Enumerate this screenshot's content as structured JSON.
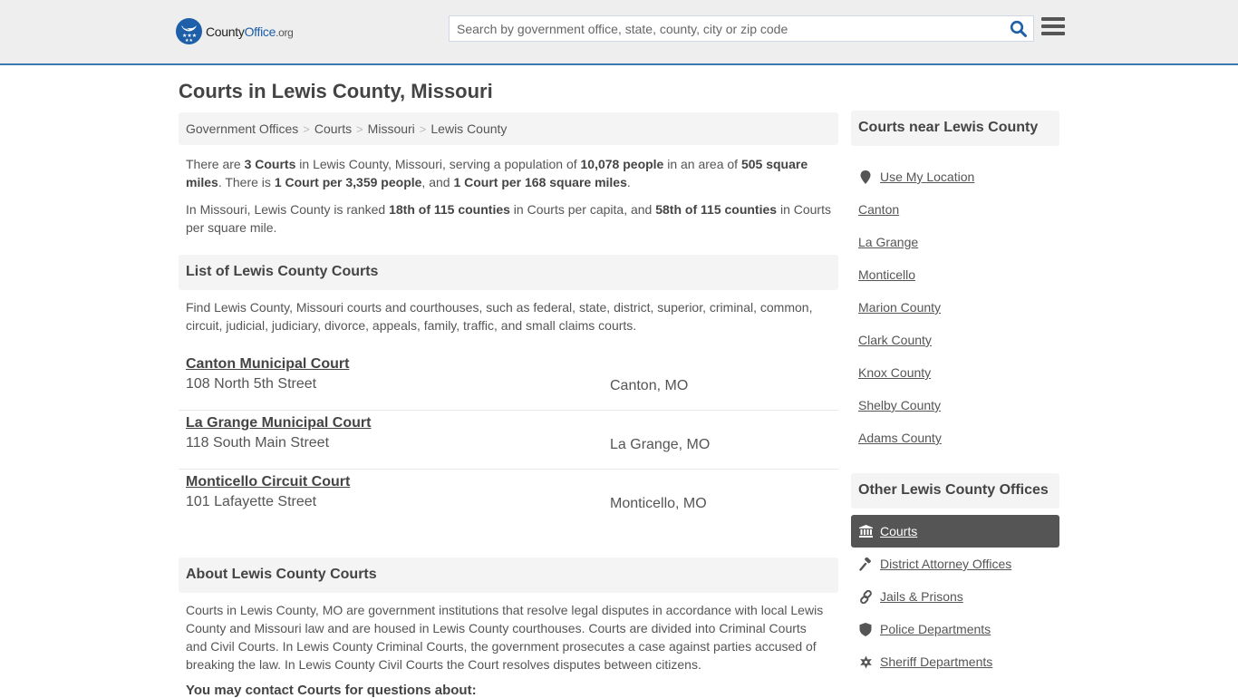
{
  "header": {
    "logo": {
      "county": "County",
      "office": "Office",
      "org": ".org",
      "icon": "eagle-badge-icon"
    },
    "search": {
      "placeholder": "Search by government office, state, county, city or zip code",
      "value": "",
      "icon": "search-icon"
    },
    "menu_icon": "hamburger-menu-icon",
    "colors": {
      "brand": "#1d5fa8",
      "header_bg": "#eeeeee",
      "header_border": "#3a7ab0"
    }
  },
  "page": {
    "title": "Courts in Lewis County, Missouri",
    "breadcrumb": [
      {
        "label": "Government Offices"
      },
      {
        "label": "Courts"
      },
      {
        "label": "Missouri"
      },
      {
        "label": "Lewis County"
      }
    ],
    "breadcrumb_separator": ">",
    "summary": {
      "s1": "There are ",
      "b1": "3 Courts",
      "s2": " in Lewis County, Missouri, serving a population of ",
      "b2": "10,078 people",
      "s3": " in an area of ",
      "b3": "505 square miles",
      "s4": ". There is ",
      "b4": "1 Court per 3,359 people",
      "s5": ", and ",
      "b5": "1 Court per 168 square miles",
      "s6": "."
    },
    "ranking": {
      "s1": "In Missouri, Lewis County is ranked ",
      "b1": "18th of 115 counties",
      "s2": " in Courts per capita, and ",
      "b2": "58th of 115 counties",
      "s3": " in Courts per square mile."
    },
    "list_section": {
      "heading": "List of Lewis County Courts",
      "description": "Find Lewis County, Missouri courts and courthouses, such as federal, state, district, superior, criminal, common, circuit, judicial, judiciary, divorce, appeals, family, traffic, and small claims courts.",
      "courts": [
        {
          "name": "Canton Municipal Court",
          "address": "108 North 5th Street",
          "city": "Canton, MO"
        },
        {
          "name": "La Grange Municipal Court",
          "address": "118 South Main Street",
          "city": "La Grange, MO"
        },
        {
          "name": "Monticello Circuit Court",
          "address": "101 Lafayette Street",
          "city": "Monticello, MO"
        }
      ]
    },
    "about_section": {
      "heading": "About Lewis County Courts",
      "body": "Courts in Lewis County, MO are government institutions that resolve legal disputes in accordance with local Lewis County and Missouri law and are housed in Lewis County courthouses. Courts are divided into Criminal Courts and Civil Courts. In Lewis County Criminal Courts, the government prosecutes a case against parties accused of breaking the law. In Lewis County Civil Courts the Court resolves disputes between citizens.",
      "contact_heading": "You may contact Courts for questions about:"
    }
  },
  "sidebar": {
    "nearby": {
      "heading": "Courts near Lewis County",
      "use_location": {
        "label": "Use My Location",
        "icon": "map-marker-icon"
      },
      "items": [
        {
          "label": "Canton"
        },
        {
          "label": "La Grange"
        },
        {
          "label": "Monticello"
        },
        {
          "label": "Marion County"
        },
        {
          "label": "Clark County"
        },
        {
          "label": "Knox County"
        },
        {
          "label": "Shelby County"
        },
        {
          "label": "Adams County"
        }
      ]
    },
    "offices": {
      "heading": "Other Lewis County Offices",
      "items": [
        {
          "label": "Courts",
          "icon": "courthouse-icon",
          "active": true
        },
        {
          "label": "District Attorney Offices",
          "icon": "gavel-icon",
          "active": false
        },
        {
          "label": "Jails & Prisons",
          "icon": "chain-link-icon",
          "active": false
        },
        {
          "label": "Police Departments",
          "icon": "shield-icon",
          "active": false
        },
        {
          "label": "Sheriff Departments",
          "icon": "sheriff-star-icon",
          "active": false
        }
      ]
    }
  }
}
